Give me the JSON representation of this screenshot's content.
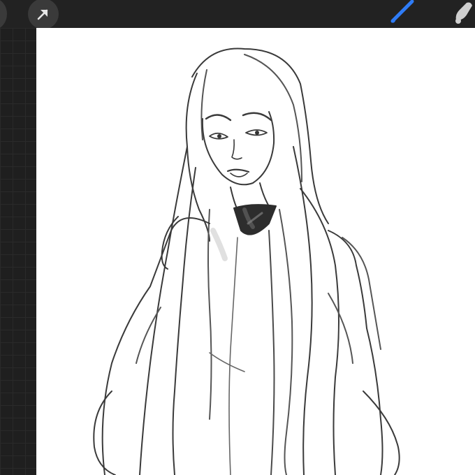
{
  "app": {
    "background_color": "#1c1c1c",
    "toolbar_color": "#222222",
    "accent_color": "#2f7cf6"
  },
  "toolbar": {
    "left_tools": [
      {
        "icon": "adjustments-icon"
      },
      {
        "icon": "selection-arrow-icon"
      }
    ],
    "right_tools": [
      {
        "icon": "brush-icon",
        "active": true
      },
      {
        "icon": "smudge-icon",
        "active": false
      }
    ]
  },
  "canvas": {
    "background_color": "#ffffff",
    "artwork": "pencil-sketch-long-haired-woman"
  }
}
